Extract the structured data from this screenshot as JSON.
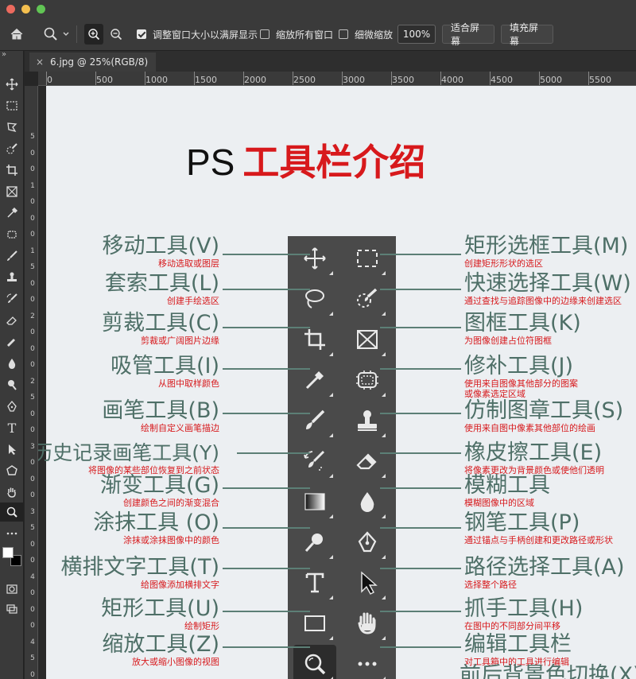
{
  "window": {
    "traffic_colors": [
      "#ec6a5e",
      "#f4bf4f",
      "#61c554"
    ]
  },
  "options_bar": {
    "resize_windows_label": "调整窗口大小以满屏显示",
    "zoom_all_label": "缩放所有窗口",
    "scrubby_zoom_label": "细微缩放",
    "zoom_value": "100%",
    "fit_screen_label": "适合屏幕",
    "fill_screen_label": "填充屏幕"
  },
  "tab": {
    "title": "6.jpg @ 25%(RGB/8)",
    "close_glyph": "×"
  },
  "collapse_glyph": "»",
  "rulers": {
    "h": [
      "0",
      "500",
      "1000",
      "1500",
      "2000",
      "2500",
      "3000",
      "3500",
      "4000",
      "4500",
      "5000",
      "5500"
    ],
    "v": [
      "5",
      "0",
      "0",
      "1",
      "0",
      "0",
      "0",
      "1",
      "5",
      "0",
      "0",
      "2",
      "0",
      "0",
      "0",
      "2",
      "5",
      "0",
      "0",
      "3",
      "0",
      "0",
      "0",
      "3",
      "5",
      "0",
      "0",
      "4",
      "0",
      "0",
      "0",
      "4",
      "5",
      "0",
      "0"
    ]
  },
  "document": {
    "title_en": "PS",
    "title_cn": "工具栏介绍",
    "left_tools": [
      {
        "name": "移动工具(V)",
        "desc": "移动选取或图层"
      },
      {
        "name": "套索工具(L)",
        "desc": "创建手绘选区"
      },
      {
        "name": "剪裁工具(C)",
        "desc": "剪裁或广阔图片边缘"
      },
      {
        "name": "吸管工具(I)",
        "desc": "从图中取样颜色"
      },
      {
        "name": "画笔工具(B)",
        "desc": "绘制自定义画笔描边"
      },
      {
        "name": "历史记录画笔工具(Y)",
        "desc": "将图像的某些部位恢复到之前状态"
      },
      {
        "name": "渐变工具(G)",
        "desc": "创建颜色之间的渐变混合"
      },
      {
        "name": "涂抹工具 (O)",
        "desc": "涂抹或涂抹图像中的颜色"
      },
      {
        "name": "横排文字工具(T)",
        "desc": "给图像添加横排文字"
      },
      {
        "name": "矩形工具(U)",
        "desc": "绘制矩形"
      },
      {
        "name": "缩放工具(Z)",
        "desc": "放大或缩小图像的视图"
      }
    ],
    "right_tools": [
      {
        "name": "矩形选框工具(M)",
        "desc": "创建矩形形状的选区"
      },
      {
        "name": "快速选择工具(W)",
        "desc": "通过查找与追踪图像中的边缘来创建选区"
      },
      {
        "name": "图框工具(K)",
        "desc": "为图像创建占位符图框"
      },
      {
        "name": "修补工具(J)",
        "desc": "使用来自图像其他部分的图案",
        "desc2": "或像素选定区域"
      },
      {
        "name": "仿制图章工具(S)",
        "desc": "使用来自图中像素其他部位的绘画"
      },
      {
        "name": "橡皮擦工具(E)",
        "desc": "将像素更改为背景颜色或使他们透明"
      },
      {
        "name": "模糊工具",
        "desc": "模糊图像中的区域"
      },
      {
        "name": "钢笔工具(P)",
        "desc": "通过锚点与手柄创建和更改路径或形状"
      },
      {
        "name": "路径选择工具(A)",
        "desc": "选择整个路径"
      },
      {
        "name": "抓手工具(H)",
        "desc": "在图中的不同部分间平移"
      },
      {
        "name": "编辑工具栏",
        "desc": "对工具箱中的工具进行编辑"
      }
    ],
    "panel_text_glyph": "T",
    "cut_off_text": "前后背景色切换(X)"
  },
  "colors": {
    "label_green": "#4e6f67",
    "accent_red": "#d7191c",
    "panel_bg": "#4a4a4a"
  }
}
